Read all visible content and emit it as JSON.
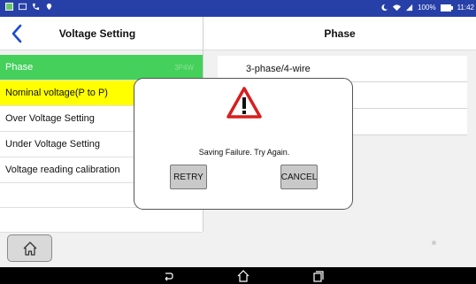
{
  "status_bar": {
    "battery": "100%",
    "time": "11:42"
  },
  "header": {
    "left_title": "Voltage Setting",
    "right_title": "Phase"
  },
  "menu": {
    "items": [
      {
        "label": "Phase",
        "value": "3P4W"
      },
      {
        "label": "Nominal voltage(P to P)"
      },
      {
        "label": "Over Voltage Setting"
      },
      {
        "label": "Under Voltage Setting"
      },
      {
        "label": "Voltage reading calibration"
      }
    ]
  },
  "options": {
    "items": [
      {
        "label": "3-phase/4-wire"
      },
      {
        "label": ""
      },
      {
        "label": ""
      }
    ]
  },
  "dialog": {
    "message": "Saving Failure. Try Again.",
    "retry_label": "RETRY",
    "cancel_label": "CANCEL"
  },
  "colors": {
    "status_bar": "#2740a8",
    "active_item": "#44d05a",
    "highlight_item": "#ffff00",
    "warning_red": "#d81e1e"
  },
  "icons": {
    "back": "chevron-left-icon",
    "home": "home-icon",
    "warning": "warning-triangle-icon",
    "nav_back": "back-arrow-icon",
    "nav_home": "home-outline-icon",
    "nav_recents": "recents-icon"
  }
}
